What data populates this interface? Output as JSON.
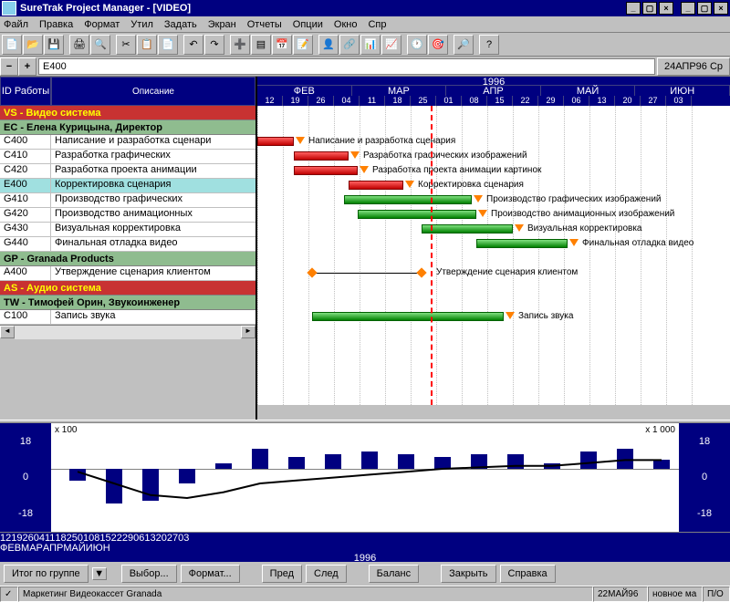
{
  "title": "SureTrak Project Manager - [VIDEO]",
  "menus": [
    "Файл",
    "Правка",
    "Формат",
    "Утил",
    "Задать",
    "Экран",
    "Отчеты",
    "Опции",
    "Окно",
    "Спр"
  ],
  "id_input": "E400",
  "date_display": "24АПР96 Ср",
  "left_headers": {
    "id": "ID\nРаботы",
    "desc": "Описание"
  },
  "groups": [
    {
      "type": "red",
      "label": "VS - Видео система"
    },
    {
      "type": "grn",
      "label": "EC - Елена Курицына, Директор"
    },
    {
      "type": "row",
      "id": "C400",
      "desc": "Написание и разработка сценари"
    },
    {
      "type": "row",
      "id": "C410",
      "desc": "Разработка графических"
    },
    {
      "type": "row",
      "id": "C420",
      "desc": "Разработка проекта анимации"
    },
    {
      "type": "row",
      "id": "E400",
      "desc": "Корректировка сценария",
      "sel": true
    },
    {
      "type": "row",
      "id": "G410",
      "desc": "Производство графических"
    },
    {
      "type": "row",
      "id": "G420",
      "desc": "Производство анимационных"
    },
    {
      "type": "row",
      "id": "G430",
      "desc": "Визуальная корректировка"
    },
    {
      "type": "row",
      "id": "G440",
      "desc": "Финальная отладка видео"
    },
    {
      "type": "grn",
      "label": "GP - Granada Products"
    },
    {
      "type": "row",
      "id": "A400",
      "desc": "Утверждение сценария клиентом"
    },
    {
      "type": "red",
      "label": "AS - Аудио система"
    },
    {
      "type": "grn",
      "label": "TW - Тимофей Орин, Звукоинженер"
    },
    {
      "type": "row",
      "id": "C100",
      "desc": "Запись звука"
    }
  ],
  "year": "1996",
  "months": [
    "ФЕВ",
    "МАР",
    "АПР",
    "МАЙ",
    "ИЮН"
  ],
  "days": [
    "12",
    "19",
    "26",
    "04",
    "11",
    "18",
    "25",
    "01",
    "08",
    "15",
    "22",
    "29",
    "06",
    "13",
    "20",
    "27",
    "03"
  ],
  "gantt_rows": [
    {
      "label": "Написание и разработка сценария",
      "start": 0,
      "len": 40,
      "color": "red",
      "y": 34
    },
    {
      "label": "Разработка графических изображений",
      "start": 40,
      "len": 60,
      "color": "red",
      "y": 50
    },
    {
      "label": "Разработка проекта анимации картинок",
      "start": 40,
      "len": 70,
      "color": "red",
      "y": 66
    },
    {
      "label": "Корректировка сценария",
      "start": 100,
      "len": 60,
      "color": "red",
      "y": 82
    },
    {
      "label": "Производство графических изображений",
      "start": 95,
      "len": 140,
      "color": "grn",
      "y": 98
    },
    {
      "label": "Производство анимационных изображений",
      "start": 110,
      "len": 130,
      "color": "grn",
      "y": 114
    },
    {
      "label": "Визуальная корректировка",
      "start": 180,
      "len": 100,
      "color": "grn",
      "y": 130
    },
    {
      "label": "Финальная отладка видео",
      "start": 240,
      "len": 100,
      "color": "grn",
      "y": 146
    },
    {
      "label": "Утверждение сценария клиентом",
      "start": 60,
      "len": 120,
      "color": "line",
      "y": 178
    },
    {
      "label": "Запись звука",
      "start": 60,
      "len": 210,
      "color": "grn",
      "y": 226
    }
  ],
  "chart_data": {
    "type": "bar",
    "left_label": "x 100",
    "right_label": "x 1 000",
    "y_ticks": [
      "18",
      "0",
      "-18"
    ],
    "categories": [
      "12",
      "19",
      "26",
      "04",
      "11",
      "18",
      "25",
      "01",
      "08",
      "15",
      "22",
      "29",
      "06",
      "13",
      "20",
      "27",
      "03"
    ],
    "values": [
      -8,
      -24,
      -22,
      -10,
      4,
      14,
      8,
      10,
      12,
      10,
      8,
      10,
      10,
      4,
      12,
      14,
      6
    ],
    "line_values": [
      -2,
      -10,
      -18,
      -20,
      -16,
      -10,
      -8,
      -6,
      -4,
      -2,
      0,
      1,
      2,
      2,
      4,
      6,
      6
    ],
    "ylim": [
      -28,
      18
    ]
  },
  "buttons": {
    "group": "Итог по группе",
    "sel": "Выбор...",
    "fmt": "Формат...",
    "prev": "Пред",
    "next": "След",
    "bal": "Баланс",
    "close": "Закрыть",
    "help": "Справка"
  },
  "status": {
    "s1": "Маркетинг Видеокассет Granada",
    "s2": "22МАЙ96",
    "s3": "новное ма",
    "s4": "П/О"
  }
}
